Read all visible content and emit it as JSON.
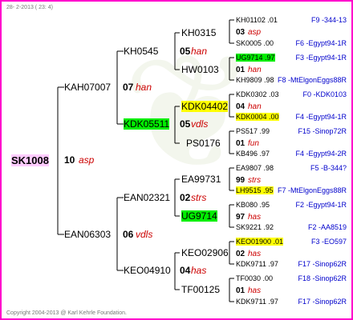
{
  "header": "28- 2-2013 ( 23: 4)",
  "footer": "Copyright 2004-2013 @ Karl Kehrle Foundation.",
  "gen1": {
    "id": "SK1008"
  },
  "gen2": [
    {
      "num": "10",
      "year": "asp"
    },
    {
      "id": "KAH07007",
      "num": "07",
      "year": "han"
    },
    {
      "id": "EAN06303",
      "num": "06",
      "year": "vdls"
    }
  ],
  "gen3": [
    {
      "id": "KH0545",
      "num": "05",
      "year": "han"
    },
    {
      "id": "KDK05511",
      "num": "05",
      "year": "vdls"
    },
    {
      "id": "EAN02321",
      "num": "02",
      "year": "strs"
    },
    {
      "id": "KEO04910",
      "num": "04",
      "year": "has"
    }
  ],
  "gen4": [
    {
      "id": "KH0315",
      "num": "03",
      "year": "asp"
    },
    {
      "id": "HW0103",
      "num": "01",
      "year": "han"
    },
    {
      "id": "KDK04402",
      "num": "04",
      "year": "han"
    },
    {
      "id": "PS0176",
      "num": "01",
      "year": "fun"
    },
    {
      "id": "EA99731",
      "num": "99",
      "year": "strs"
    },
    {
      "id": "UG9714",
      "num": "97",
      "year": "has"
    },
    {
      "id": "KEO02906",
      "num": "02",
      "year": "has"
    },
    {
      "id": "TF00125",
      "num": "01",
      "year": "has"
    }
  ],
  "gen5": [
    {
      "id": "KH01102 .01",
      "origin": "F9 -344-13"
    },
    {
      "id": "SK0005 .00",
      "origin": "F6 -Egypt94-1R"
    },
    {
      "id": "UG9714 .97",
      "origin": "F3 -Egypt94-1R"
    },
    {
      "id": "KH9809 .98",
      "origin": "F8 -MtElgonEggs88R"
    },
    {
      "id": "KDK0302 .03",
      "origin": "F0 -KDK0103"
    },
    {
      "id": "KDK0004 .00",
      "origin": "F4 -Egypt94-1R"
    },
    {
      "id": "PS517 .99",
      "origin": "F15 -Sinop72R"
    },
    {
      "id": "KB496 .97",
      "origin": "F4 -Egypt94-2R"
    },
    {
      "id": "EA9807 .98",
      "origin": "F5 -B-344?"
    },
    {
      "id": "LH9515 .95",
      "origin": "F7 -MtElgonEggs88R"
    },
    {
      "id": "KB080 .95",
      "origin": "F2 -Egypt94-1R"
    },
    {
      "id": "SK9221 .92",
      "origin": "F2 -AA8519"
    },
    {
      "id": "KEO01900 .01",
      "origin": "F3 -EO597"
    },
    {
      "id": "KDK9711 .97",
      "origin": "F17 -Sinop62R"
    },
    {
      "id": "TF0030 .00",
      "origin": "F18 -Sinop62R"
    },
    {
      "id": "KDK9711 .97",
      "origin": "F17 -Sinop62R"
    }
  ]
}
